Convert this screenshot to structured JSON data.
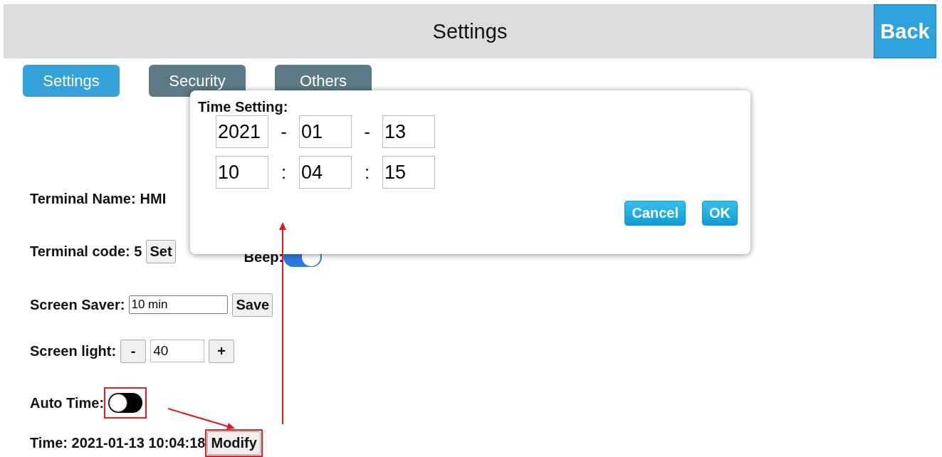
{
  "header": {
    "title": "Settings",
    "back_button": "Back"
  },
  "tabs": [
    {
      "label": "Settings",
      "selected": true
    },
    {
      "label": "Security",
      "selected": false
    },
    {
      "label": "Others",
      "selected": false
    }
  ],
  "terminal_name": {
    "label": "Terminal Name:",
    "value": "HMI"
  },
  "terminal_code": {
    "label": "Terminal code: 5",
    "button": "Set"
  },
  "beep": {
    "label": "Beep:",
    "on": true
  },
  "screen_saver": {
    "label": "Screen Saver:",
    "value": "10 min",
    "button": "Save"
  },
  "screen_light": {
    "label": "Screen light:",
    "decrease": "-",
    "value": "40",
    "increase": "+"
  },
  "auto_time": {
    "label": "Auto Time:",
    "on": false,
    "highlighted": true,
    "arrow": true
  },
  "time": {
    "label": "Time: 2021-01-13 10:04:18",
    "button": "Modify",
    "highlighted": true,
    "arrow": true
  },
  "dialog": {
    "title": "Time Setting:",
    "rows": [
      {
        "fields": [
          "2021",
          "01",
          "13"
        ],
        "separator": "-"
      },
      {
        "fields": [
          "10",
          "04",
          "15"
        ],
        "separator": ":"
      }
    ],
    "buttons": [
      "Cancel",
      "OK"
    ]
  }
}
